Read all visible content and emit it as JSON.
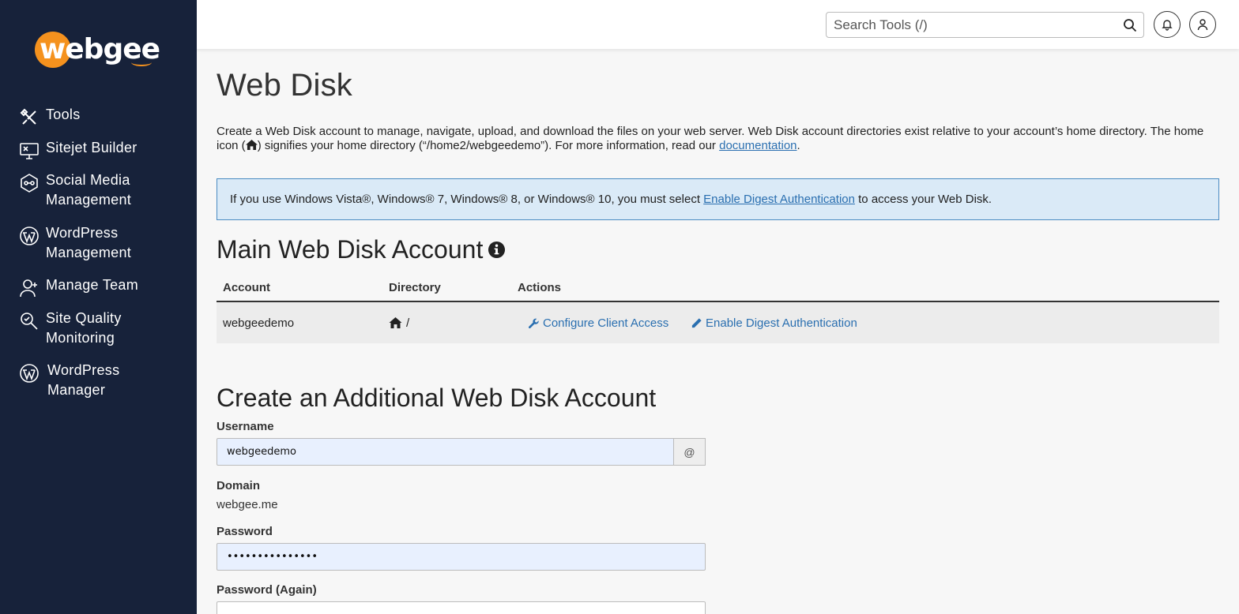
{
  "brand": {
    "name": "webgee",
    "accent": "#f5921e",
    "sidebar_bg": "#17223a"
  },
  "sidebar": {
    "items": [
      {
        "label": "Tools",
        "icon": "tools-icon"
      },
      {
        "label": "Sitejet Builder",
        "icon": "monitor-icon"
      },
      {
        "label": "Social Media Management",
        "icon": "social-icon"
      },
      {
        "label": "WordPress Management",
        "icon": "wordpress-icon"
      },
      {
        "label": "Manage Team",
        "icon": "user-add-icon"
      },
      {
        "label": "Site Quality Monitoring",
        "icon": "search-check-icon"
      },
      {
        "label": "WordPress Manager",
        "icon": "wordpress-icon"
      }
    ]
  },
  "topbar": {
    "search_placeholder": "Search Tools (/)"
  },
  "page": {
    "title": "Web Disk",
    "intro_part1": "Create a Web Disk account to manage, navigate, upload, and download the files on your web server. Web Disk account directories exist relative to your account’s home directory. The home icon (",
    "intro_part2": ") signifies your home directory (“/home2/webgeedemo”). For more information, read our ",
    "intro_link": "documentation",
    "intro_end": ".",
    "alert_part1": "If you use Windows Vista®, Windows® 7, Windows® 8, or Windows® 10, you must select ",
    "alert_link": "Enable Digest Authentication",
    "alert_part2": " to access your Web Disk."
  },
  "main_account": {
    "title": "Main Web Disk Account",
    "columns": [
      "Account",
      "Directory",
      "Actions"
    ],
    "row": {
      "account": "webgeedemo",
      "directory": "/",
      "action_configure": "Configure Client Access",
      "action_digest": "Enable Digest Authentication"
    }
  },
  "create_form": {
    "title": "Create an Additional Web Disk Account",
    "username_label": "Username",
    "username_value": "webgeedemo",
    "username_addon": "@",
    "domain_label": "Domain",
    "domain_value": "webgee.me",
    "password_label": "Password",
    "password_value": "•••••••••••••••",
    "password_again_label": "Password (Again)"
  }
}
